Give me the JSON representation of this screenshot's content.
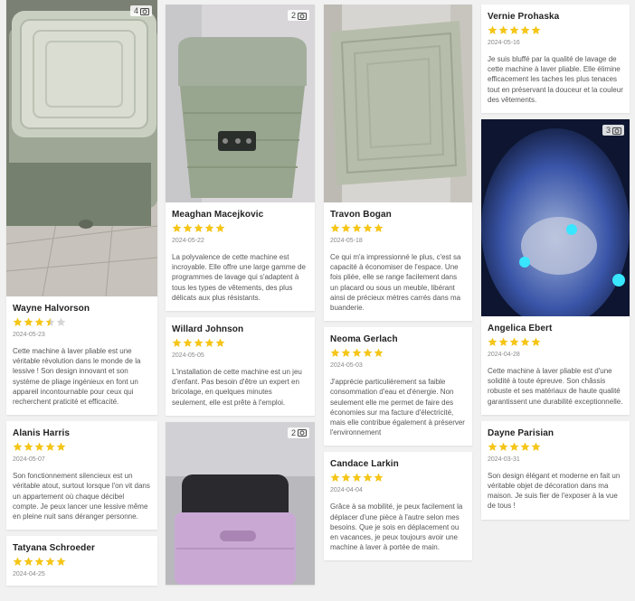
{
  "colors": {
    "star": "#f5c518",
    "star_empty": "#d6d6d6"
  },
  "reviews": {
    "r1": {
      "photo_count": "4",
      "name": "Wayne Halvorson",
      "rating": 3.5,
      "date": "2024-05-23",
      "text": "Cette machine à laver pliable est une véritable révolution dans le monde de la lessive ! Son design innovant et son système de pliage ingénieux en font un appareil incontournable pour ceux qui recherchent praticité et efficacité."
    },
    "r2": {
      "name": "Alanis Harris",
      "rating": 5,
      "date": "2024-05-07",
      "text": "Son fonctionnement silencieux est un véritable atout, surtout lorsque l'on vit dans un appartement où chaque décibel compte. Je peux lancer une lessive même en pleine nuit sans déranger personne."
    },
    "r3": {
      "name": "Tatyana Schroeder",
      "rating": 5,
      "date": "2024-04-25",
      "text": ""
    },
    "r4": {
      "photo_count": "2",
      "name": "Meaghan Macejkovic",
      "rating": 5,
      "date": "2024-05-22",
      "text": "La polyvalence de cette machine est incroyable. Elle offre une large gamme de programmes de lavage qui s'adaptent à tous les types de vêtements, des plus délicats aux plus résistants."
    },
    "r5": {
      "name": "Willard Johnson",
      "rating": 5,
      "date": "2024-05-05",
      "text": "L'installation de cette machine est un jeu d'enfant. Pas besoin d'être un expert en bricolage, en quelques minutes seulement, elle est prête à l'emploi."
    },
    "r6": {
      "photo_count": "2"
    },
    "r7": {
      "name": "Travon Bogan",
      "rating": 5,
      "date": "2024-05-18",
      "text": "Ce qui m'a impressionné le plus, c'est sa capacité à économiser de l'espace. Une fois pliée, elle se range facilement dans un placard ou sous un meuble, libérant ainsi de précieux mètres carrés dans ma buanderie."
    },
    "r8": {
      "name": "Neoma Gerlach",
      "rating": 5,
      "date": "2024-05-03",
      "text": "J'apprécie particulièrement sa faible consommation d'eau et d'énergie. Non seulement elle me permet de faire des économies sur ma facture d'électricité, mais elle contribue également à préserver l'environnement"
    },
    "r9": {
      "name": "Candace Larkin",
      "rating": 5,
      "date": "2024-04-04",
      "text": "Grâce à sa mobilité, je peux facilement la déplacer d'une pièce à l'autre selon mes besoins. Que je sois en déplacement ou en vacances, je peux toujours avoir une machine à laver à portée de main."
    },
    "r10": {
      "name": "Vernie Prohaska",
      "rating": 5,
      "date": "2024-05-16",
      "text": "Je suis bluffé par la qualité de lavage de cette machine à laver pliable. Elle élimine efficacement les taches les plus tenaces tout en préservant la douceur et la couleur des vêtements."
    },
    "r11": {
      "photo_count": "3",
      "name": "Angelica Ebert",
      "rating": 5,
      "date": "2024-04-28",
      "text": "Cette machine à laver pliable est d'une solidité à toute épreuve. Son châssis robuste et ses matériaux de haute qualité garantissent une durabilité exceptionnelle."
    },
    "r12": {
      "name": "Dayne Parisian",
      "rating": 5,
      "date": "2024-03-31",
      "text": "Son design élégant et moderne en fait un véritable objet de décoration dans ma maison. Je suis fier de l'exposer à la vue de tous !"
    }
  }
}
